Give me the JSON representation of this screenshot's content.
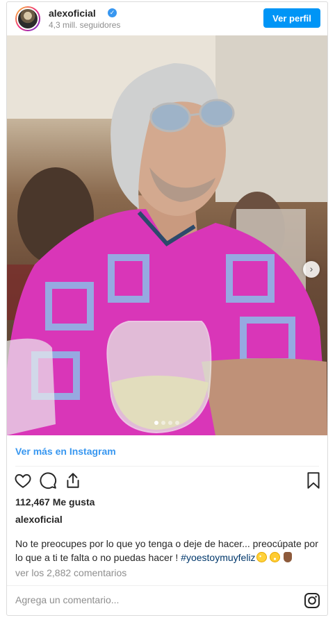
{
  "header": {
    "username": "alexoficial",
    "verified_mark": "✓",
    "followers": "4,3 mill. seguidores",
    "view_profile_label": "Ver perfil"
  },
  "post": {
    "carousel": {
      "dots": 4,
      "active_index": 0,
      "next_glyph": "›"
    },
    "see_more_label": "Ver más en Instagram",
    "likes": "112,467 Me gusta",
    "author": "alexoficial",
    "caption_text": "No te preocupes por lo que yo tenga o deje de hacer... preocúpate por lo que a ti te falta o no puedas hacer ! ",
    "hashtag": "#yoestoymuyfeliz",
    "comments_link": "ver los 2,882 comentarios",
    "add_comment_placeholder": "Agrega un comentario..."
  },
  "icons": {
    "like": "heart-icon",
    "comment": "comment-icon",
    "share": "share-icon",
    "save": "bookmark-icon",
    "instagram": "instagram-icon"
  },
  "colors": {
    "accent": "#0095f6",
    "link": "#3897f0",
    "hashtag": "#00376b",
    "muted": "#8e8e8e",
    "shirt_pink": "#d936b8",
    "shirt_blue": "#8fb6e6"
  }
}
